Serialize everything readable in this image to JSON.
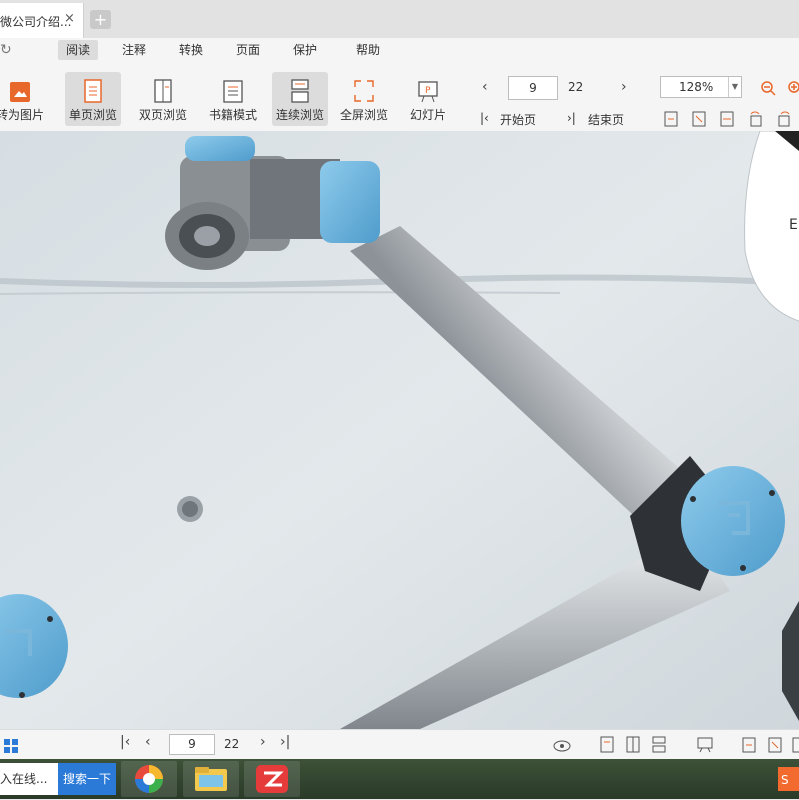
{
  "tab": {
    "title": "微公司介绍...",
    "close": "×",
    "new": "+"
  },
  "menu": [
    "阅读",
    "注释",
    "转换",
    "页面",
    "保护",
    "帮助"
  ],
  "toolbar": {
    "to_image": "转为图片",
    "single": "单页浏览",
    "double": "双页浏览",
    "book": "书籍模式",
    "continuous": "连续浏览",
    "fullscreen": "全屏浏览",
    "slideshow": "幻灯片",
    "first_page": "开始页",
    "last_page": "结束页"
  },
  "navigation": {
    "current_page": "9",
    "total_pages": "22"
  },
  "zoom": {
    "value": "128%"
  },
  "doc_side_text": "E",
  "status": {
    "current_page": "9",
    "total_pages": "22"
  },
  "taskbar": {
    "search_placeholder": "入在线...",
    "search_button": "搜索一下"
  },
  "colors": {
    "accent": "#e8672a",
    "arm_cap": "#6fb4dc",
    "taskbar_button": "#2b7ad8"
  }
}
